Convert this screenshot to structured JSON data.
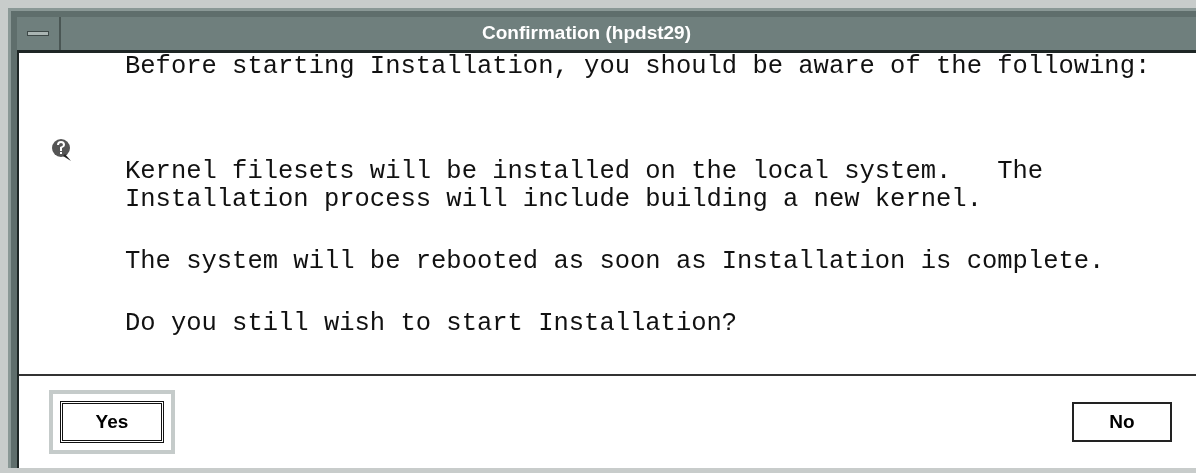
{
  "window": {
    "title": "Confirmation (hpdst29)"
  },
  "message": {
    "paragraphs": [
      {
        "lines": [
          "Before starting Installation, you should be aware of the following:"
        ]
      },
      {
        "lines": [
          "Kernel filesets will be installed on the local system.   The",
          "Installation process will include building a new kernel."
        ]
      },
      {
        "lines": [
          "The system will be rebooted as soon as Installation is complete."
        ]
      },
      {
        "lines": [
          "Do you still wish to start Installation?"
        ]
      }
    ]
  },
  "buttons": [
    {
      "label": "Yes",
      "default": true
    },
    {
      "label": "No",
      "default": false
    }
  ]
}
